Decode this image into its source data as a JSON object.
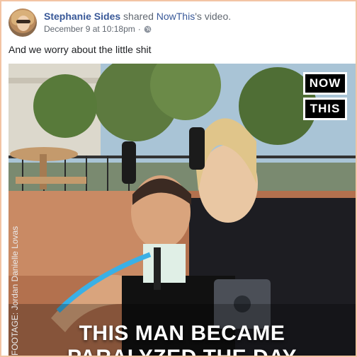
{
  "post": {
    "author_name": "Stephanie Sides",
    "action_text": " shared ",
    "shared_page": "NowThis",
    "suffix": "'s video.",
    "timestamp": "December 9 at 10:18pm",
    "separator": "·",
    "status_text": "And we worry about the little shit"
  },
  "video": {
    "logo_line1": "NOW",
    "logo_line2": "THIS",
    "caption_line1": "THIS MAN BECAME",
    "caption_line2": "PARALYZED THE DAY",
    "credit": "FOOTAGE: Jordan Danielle Lovas"
  },
  "icons": {
    "privacy": "globe-icon"
  },
  "colors": {
    "link": "#385898",
    "meta": "#606770",
    "border": "#f3c4a4"
  }
}
